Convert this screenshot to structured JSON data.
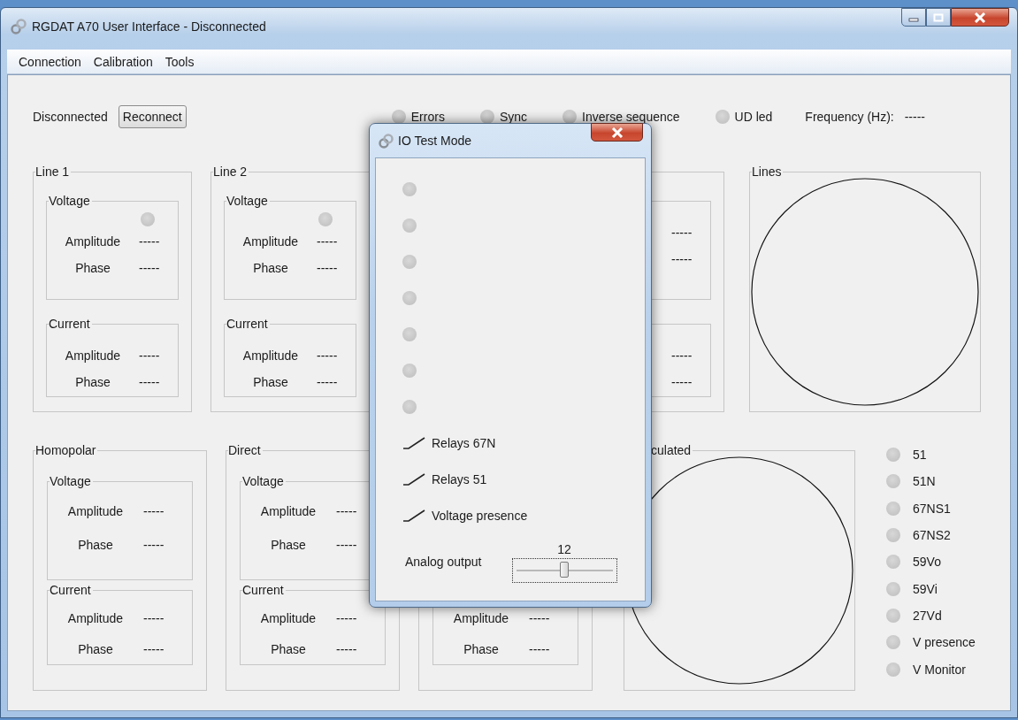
{
  "window": {
    "title": "RGDAT A70 User Interface - Disconnected"
  },
  "menu": [
    {
      "label": "Connection"
    },
    {
      "label": "Calibration"
    },
    {
      "label": "Tools"
    }
  ],
  "connection": {
    "status": "Disconnected",
    "button": "Reconnect"
  },
  "indicators": [
    {
      "label": "Errors",
      "on": false
    },
    {
      "label": "Sync",
      "on": false
    },
    {
      "label": "Inverse sequence",
      "on": false
    },
    {
      "label": "UD led",
      "on": false
    }
  ],
  "frequency": {
    "label": "Frequency (Hz):",
    "value": "-----"
  },
  "line_panels": [
    {
      "title": "Line 1",
      "groups": [
        {
          "title": "Voltage",
          "led": {
            "on": false
          },
          "rows": [
            {
              "label": "Amplitude",
              "value": "-----"
            },
            {
              "label": "Phase",
              "value": "-----"
            }
          ]
        },
        {
          "title": "Current",
          "rows": [
            {
              "label": "Amplitude",
              "value": "-----"
            },
            {
              "label": "Phase",
              "value": "-----"
            }
          ]
        }
      ]
    },
    {
      "title": "Line 2",
      "groups": [
        {
          "title": "Voltage",
          "led": {
            "on": false
          },
          "rows": [
            {
              "label": "Amplitude",
              "value": "-----"
            },
            {
              "label": "Phase",
              "value": "-----"
            }
          ]
        },
        {
          "title": "Current",
          "rows": [
            {
              "label": "Amplitude",
              "value": "-----"
            },
            {
              "label": "Phase",
              "value": "-----"
            }
          ]
        }
      ]
    },
    {
      "groups": [
        {
          "rows": [
            {
              "value": "-----"
            },
            {
              "value": "-----"
            }
          ]
        },
        {
          "rows": [
            {
              "value": "-----"
            },
            {
              "value": "-----"
            }
          ]
        }
      ]
    }
  ],
  "lines_plot": {
    "title": "Lines"
  },
  "sequence_panels": [
    {
      "title": "Homopolar",
      "groups": [
        {
          "title": "Voltage",
          "rows": [
            {
              "label": "Amplitude",
              "value": "-----"
            },
            {
              "label": "Phase",
              "value": "-----"
            }
          ]
        },
        {
          "title": "Current",
          "rows": [
            {
              "label": "Amplitude",
              "value": "-----"
            },
            {
              "label": "Phase",
              "value": "-----"
            }
          ]
        }
      ]
    },
    {
      "title": "Direct",
      "groups": [
        {
          "title": "Voltage",
          "rows": [
            {
              "label": "Amplitude",
              "value": "-----"
            },
            {
              "label": "Phase",
              "value": "-----"
            }
          ]
        },
        {
          "title": "Current",
          "rows": [
            {
              "label": "Amplitude",
              "value": "-----"
            },
            {
              "label": "Phase",
              "value": "-----"
            }
          ]
        }
      ]
    },
    {
      "groups": [
        {
          "rows": [
            {
              "label": "Amplitude",
              "value": "-----"
            },
            {
              "label": "Phase",
              "value": "-----"
            }
          ]
        }
      ]
    }
  ],
  "calculated_plot": {
    "title": "culated"
  },
  "protections": [
    {
      "label": "51",
      "on": false
    },
    {
      "label": "51N",
      "on": false
    },
    {
      "label": "67NS1",
      "on": false
    },
    {
      "label": "67NS2",
      "on": false
    },
    {
      "label": "59Vo",
      "on": false
    },
    {
      "label": "59Vi",
      "on": false
    },
    {
      "label": "27Vd",
      "on": false
    },
    {
      "label": "V presence",
      "on": false
    },
    {
      "label": "V Monitor",
      "on": false
    }
  ],
  "dialog": {
    "title": "IO Test Mode",
    "leds": [
      {
        "on": false
      },
      {
        "on": false
      },
      {
        "on": false
      },
      {
        "on": false
      },
      {
        "on": false
      },
      {
        "on": false
      },
      {
        "on": false
      }
    ],
    "relays": [
      {
        "label": "Relays 67N",
        "closed": false
      },
      {
        "label": "Relays 51",
        "closed": false
      },
      {
        "label": "Voltage presence",
        "closed": false
      }
    ],
    "analog_output": {
      "label": "Analog output",
      "value": "12",
      "level": 0.5
    }
  }
}
